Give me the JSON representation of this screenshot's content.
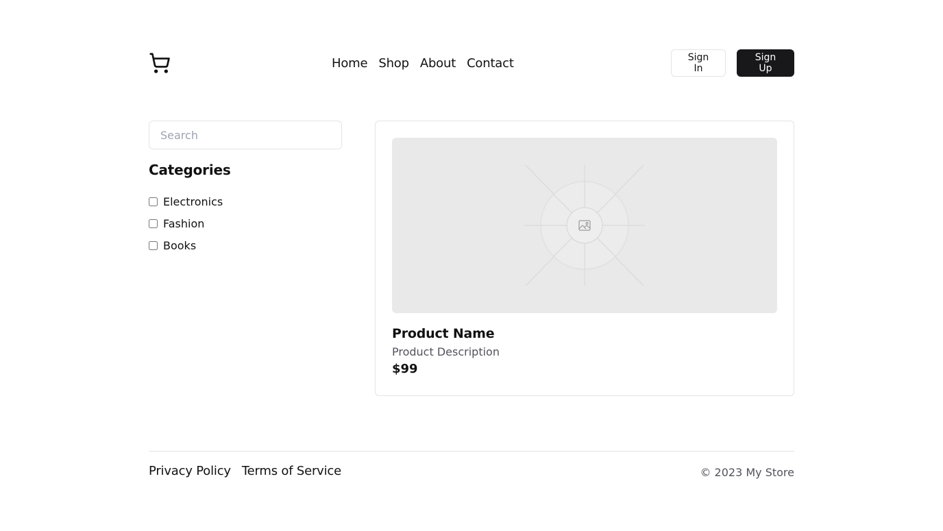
{
  "header": {
    "logo_icon": "shopping-cart-icon",
    "nav": [
      {
        "label": "Home"
      },
      {
        "label": "Shop"
      },
      {
        "label": "About"
      },
      {
        "label": "Contact"
      }
    ],
    "sign_in_label": "Sign In",
    "sign_up_label": "Sign Up"
  },
  "sidebar": {
    "search": {
      "placeholder": "Search",
      "value": ""
    },
    "categories_title": "Categories",
    "categories": [
      {
        "label": "Electronics",
        "checked": false
      },
      {
        "label": "Fashion",
        "checked": false
      },
      {
        "label": "Books",
        "checked": false
      }
    ]
  },
  "product": {
    "image_icon": "image-placeholder-icon",
    "name": "Product Name",
    "description": "Product Description",
    "price": "$99"
  },
  "footer": {
    "links": [
      {
        "label": "Privacy Policy"
      },
      {
        "label": "Terms of Service"
      }
    ],
    "copyright": "© 2023 My Store"
  },
  "colors": {
    "primary": "#18181b",
    "border": "#e4e4e7",
    "muted_text": "#52525b",
    "placeholder_bg": "#e9e9e9"
  }
}
